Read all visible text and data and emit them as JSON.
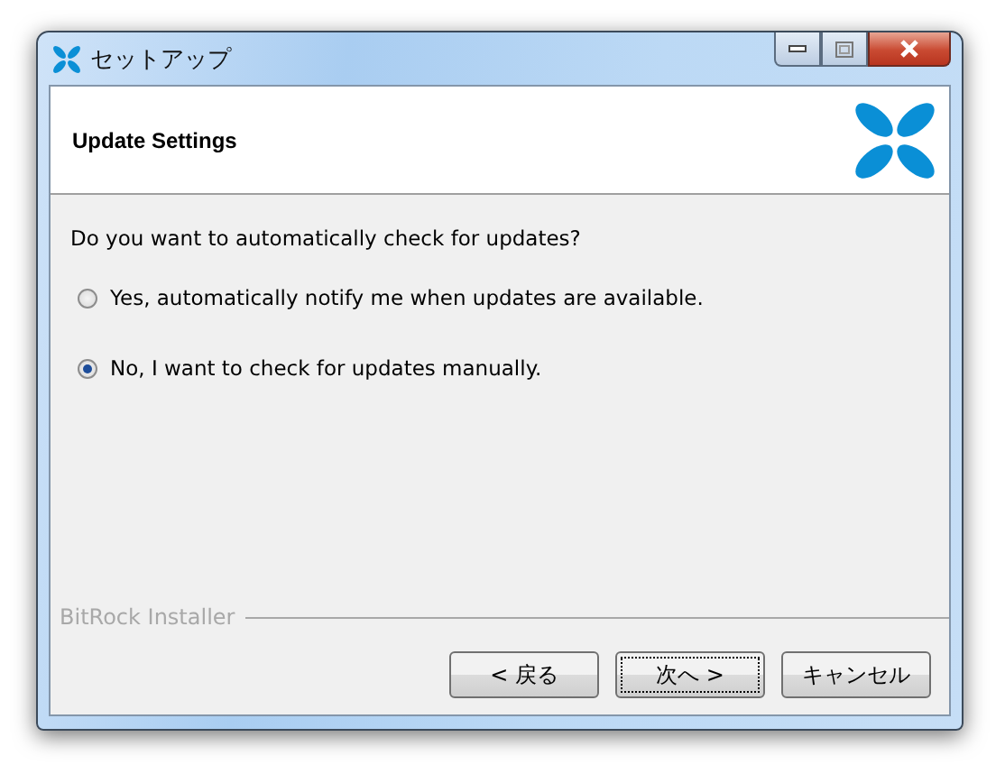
{
  "window": {
    "title": "セットアップ"
  },
  "header": {
    "title": "Update Settings"
  },
  "question": "Do you want to automatically check for updates?",
  "options": [
    {
      "label": "Yes, automatically notify me when updates are available.",
      "selected": false
    },
    {
      "label": "No, I want to check for updates manually.",
      "selected": true
    }
  ],
  "brand": "BitRock Installer",
  "buttons": [
    {
      "label": "< 戻る",
      "focused": false
    },
    {
      "label": "次へ >",
      "focused": true
    },
    {
      "label": "キャンセル",
      "focused": false
    }
  ]
}
